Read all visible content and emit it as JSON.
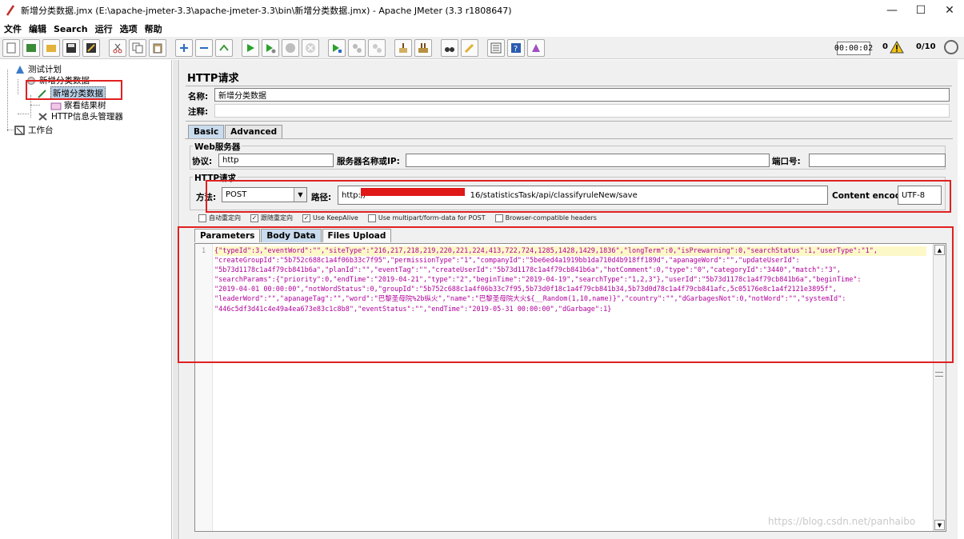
{
  "window": {
    "title": "新增分类数据.jmx (E:\\apache-jmeter-3.3\\apache-jmeter-3.3\\bin\\新增分类数据.jmx) - Apache JMeter (3.3 r1808647)",
    "minimize": "—",
    "maximize": "☐",
    "close": "✕"
  },
  "menu": [
    "文件",
    "编辑",
    "Search",
    "运行",
    "选项",
    "帮助"
  ],
  "status": {
    "timer": "00:00:02",
    "warnings": "0",
    "threads": "0/10"
  },
  "tree": {
    "test_plan": "测试计划",
    "thread_group": "新增分类数据",
    "sampler": "新增分类数据",
    "listener": "察看结果树",
    "header_manager": "HTTP信息头管理器",
    "workbench": "工作台"
  },
  "panel": {
    "title": "HTTP请求",
    "name_label": "名称:",
    "name_value": "新增分类数据",
    "comment_label": "注释:",
    "tabs": [
      "Basic",
      "Advanced"
    ],
    "web_server": {
      "group_title": "Web服务器",
      "protocol_label": "协议:",
      "protocol_value": "http",
      "server_label": "服务器名称或IP:",
      "server_value": "",
      "port_label": "端口号:",
      "port_value": ""
    },
    "http_request": {
      "group_title": "HTTP请求",
      "method_label": "方法:",
      "method_value": "POST",
      "path_label": "路径:",
      "path_prefix": "http://",
      "path_suffix": "16/statisticsTask/api/classifyruleNew/save",
      "encoding_label": "Content encoding:",
      "encoding_value": "UTF-8"
    },
    "options": [
      {
        "label": "自动重定向",
        "checked": false
      },
      {
        "label": "跟随重定向",
        "checked": true
      },
      {
        "label": "Use KeepAlive",
        "checked": true
      },
      {
        "label": "Use multipart/form-data for POST",
        "checked": false
      },
      {
        "label": "Browser-compatible headers",
        "checked": false
      }
    ],
    "body_tabs": [
      "Parameters",
      "Body Data",
      "Files Upload"
    ],
    "body_line_number": "1",
    "body_lines": [
      "{\"typeId\":3,\"eventWord\":\"\",\"siteType\":\"216,217,218,219,220,221,224,413,722,724,1285,1428,1429,1836\",\"longTerm\":0,\"isPrewarning\":0,\"searchStatus\":1,\"userType\":\"1\",",
      "\"createGroupId\":\"5b752c688c1a4f06b33c7f95\",\"permissionType\":\"1\",\"companyId\":\"5be6ed4a1919bb1da710d4b918ff189d\",\"apanageWord\":\"\",\"updateUserId\":",
      "\"5b73d1178c1a4f79cb841b6a\",\"planId\":\"\",\"eventTag\":\"\",\"createUserId\":\"5b73d1178c1a4f79cb841b6a\",\"hotComment\":0,\"type\":\"0\",\"categoryId\":\"3440\",\"match\":\"3\",",
      "\"searchParams\":{\"priority\":0,\"endTime\":\"2019-04-21\",\"type\":\"2\",\"beginTime\":\"2019-04-19\",\"searchType\":\"1,2,3\"},\"userId\":\"5b73d1178c1a4f79cb841b6a\",\"beginTime\":",
      "\"2019-04-01 00:00:00\",\"notWordStatus\":0,\"groupId\":\"5b752c688c1a4f06b33c7f95,5b73d0f18c1a4f79cb841b34,5b73d0d78c1a4f79cb841afc,5c05176e8c1a4f2121e3895f\",",
      "\"leaderWord\":\"\",\"apanageTag\":\"\",\"word\":\"巴黎圣母院%2b纵火\",\"name\":\"巴黎圣母院大火${__Random(1,10,name)}\",\"country\":\"\",\"dGarbagesNot\":0,\"notWord\":\"\",\"systemId\":",
      "\"446c5df3d41c4e49a4ea673e83c1c8b8\",\"eventStatus\":\"\",\"endTime\":\"2019-05-31 00:00:00\",\"dGarbage\":1}"
    ]
  },
  "watermark": "https://blog.csdn.net/panhaibo"
}
